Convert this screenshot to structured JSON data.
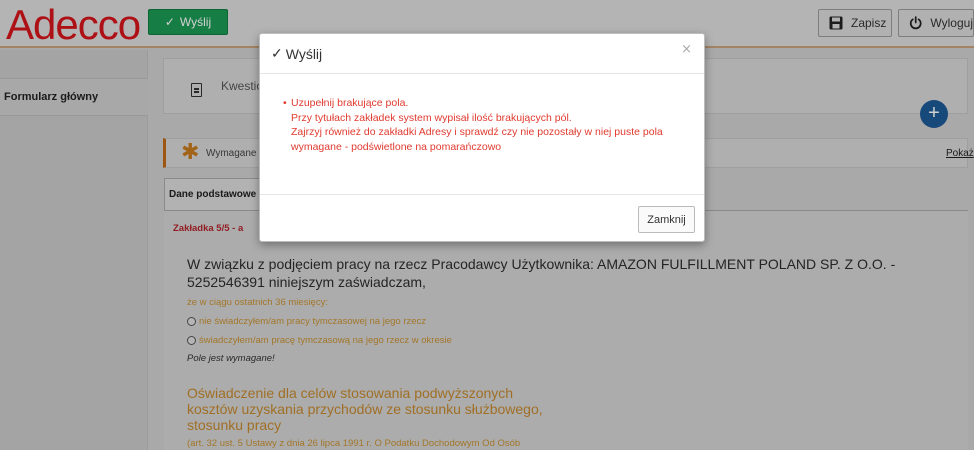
{
  "header": {
    "logo_text": "Adecco",
    "send_label": "Wyślij",
    "save_label": "Zapisz",
    "logout_label": "Wyloguj"
  },
  "sidebar": {
    "items": [
      {
        "label": "Formularz główny"
      }
    ]
  },
  "main": {
    "questionnaire_label": "Kwestiona",
    "required_text": "Wymagane",
    "show_link": "Pokaż",
    "tab_label": "Dane podstawowe",
    "tab_indicator": "Zakładka 5/5 - a",
    "statement": "W związku z podjęciem pracy na rzecz Pracodawcy Użytkownika: AMAZON FULFILLMENT POLAND SP. Z O.O. - 5252546391 niniejszym zaświadczam,",
    "period_label": "że w ciągu ostatnich 36 miesięcy:",
    "radio_options": [
      {
        "label": "nie świadczyłem/am pracy tymczasowej na jego rzecz"
      },
      {
        "label": "świadczyłem/am pracę tymczasową na jego rzecz w okresie"
      }
    ],
    "required_warning": "Pole jest wymagane!",
    "section_title": "Oświadczenie dla celów stosowania podwyższonych kosztów uzyskania przychodów ze stosunku służbowego, stosunku pracy",
    "section_ref": "(art. 32 ust. 5 Ustawy z dnia 26 lipca 1991 r. O Podatku Dochodowym Od Osób"
  },
  "modal": {
    "title": "Wyślij",
    "close_icon_glyph": "×",
    "messages": [
      "Uzupełnij brakujące pola.",
      "Przy tytułach zakładek system wypisał ilość brakujących pól.",
      "Zajrzyj również do zakładki Adresy i sprawdź czy nie pozostały w niej puste pola",
      "wymagane - podświetlone na pomarańczowo"
    ],
    "close_button_label": "Zamknij"
  },
  "colors": {
    "brand_red": "#d4151c",
    "send_green": "#1c9a55",
    "error_red": "#e03a2f",
    "warning_orange": "#c79134",
    "accent_blue": "#1e5a97"
  }
}
